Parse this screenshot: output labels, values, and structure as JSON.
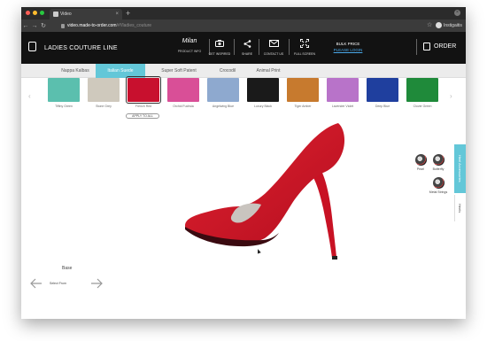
{
  "browser": {
    "tab_title": "Video",
    "tab_close": "×",
    "new_tab": "+",
    "url_host": "video.made-to-order.com",
    "url_path": "/#!/ladies_couture",
    "profile_name": "Instigaitis"
  },
  "header": {
    "brand": "LADIES COUTURE LINE",
    "model_name": "Milan",
    "model_sub": "PRODUCT INFO",
    "buttons": {
      "get_inspired": "GET INSPIRED",
      "share": "SHARE",
      "contact": "CONTACT US",
      "fullscreen": "FULL SCREEN"
    },
    "bulk_title": "BULK PRICE",
    "bulk_link": "PLEASE LOGIN",
    "order": "ORDER"
  },
  "material_tabs": [
    {
      "label": "Nappa Kalbas",
      "active": false
    },
    {
      "label": "Italian Suede",
      "active": true
    },
    {
      "label": "Super Soft Patent",
      "active": false
    },
    {
      "label": "Crocodil",
      "active": false
    },
    {
      "label": "Animal Print",
      "active": false
    }
  ],
  "swatches": [
    {
      "name": "Tiffiny Green",
      "color": "#5bbfae"
    },
    {
      "name": "Stone Grey",
      "color": "#cfc9bd"
    },
    {
      "name": "French Red",
      "color": "#c8102e",
      "selected": true
    },
    {
      "name": "Orchid Fuchsia",
      "color": "#d94f97"
    },
    {
      "name": "Angelwing Blue",
      "color": "#8ea9cf"
    },
    {
      "name": "Luxury Black",
      "color": "#1a1a1a"
    },
    {
      "name": "Tiger Amber",
      "color": "#c77a2e"
    },
    {
      "name": "Lavender Violet",
      "color": "#b873c9"
    },
    {
      "name": "Deep Blue",
      "color": "#1f3f9e"
    },
    {
      "name": "Clover Green",
      "color": "#1f8a3a"
    }
  ],
  "apply_all": "APPLY TO ALL",
  "side_tabs": {
    "accessories": "Heel Accessories",
    "heels": "Heels"
  },
  "accessories": [
    {
      "label": "Pearl"
    },
    {
      "label": "Butterfly"
    },
    {
      "label": "Metal Strings"
    }
  ],
  "bottom": {
    "base_label": "Base",
    "nav_label": "Select From"
  },
  "colors": {
    "accent": "#63c7d8",
    "shoe": "#d4152d"
  }
}
